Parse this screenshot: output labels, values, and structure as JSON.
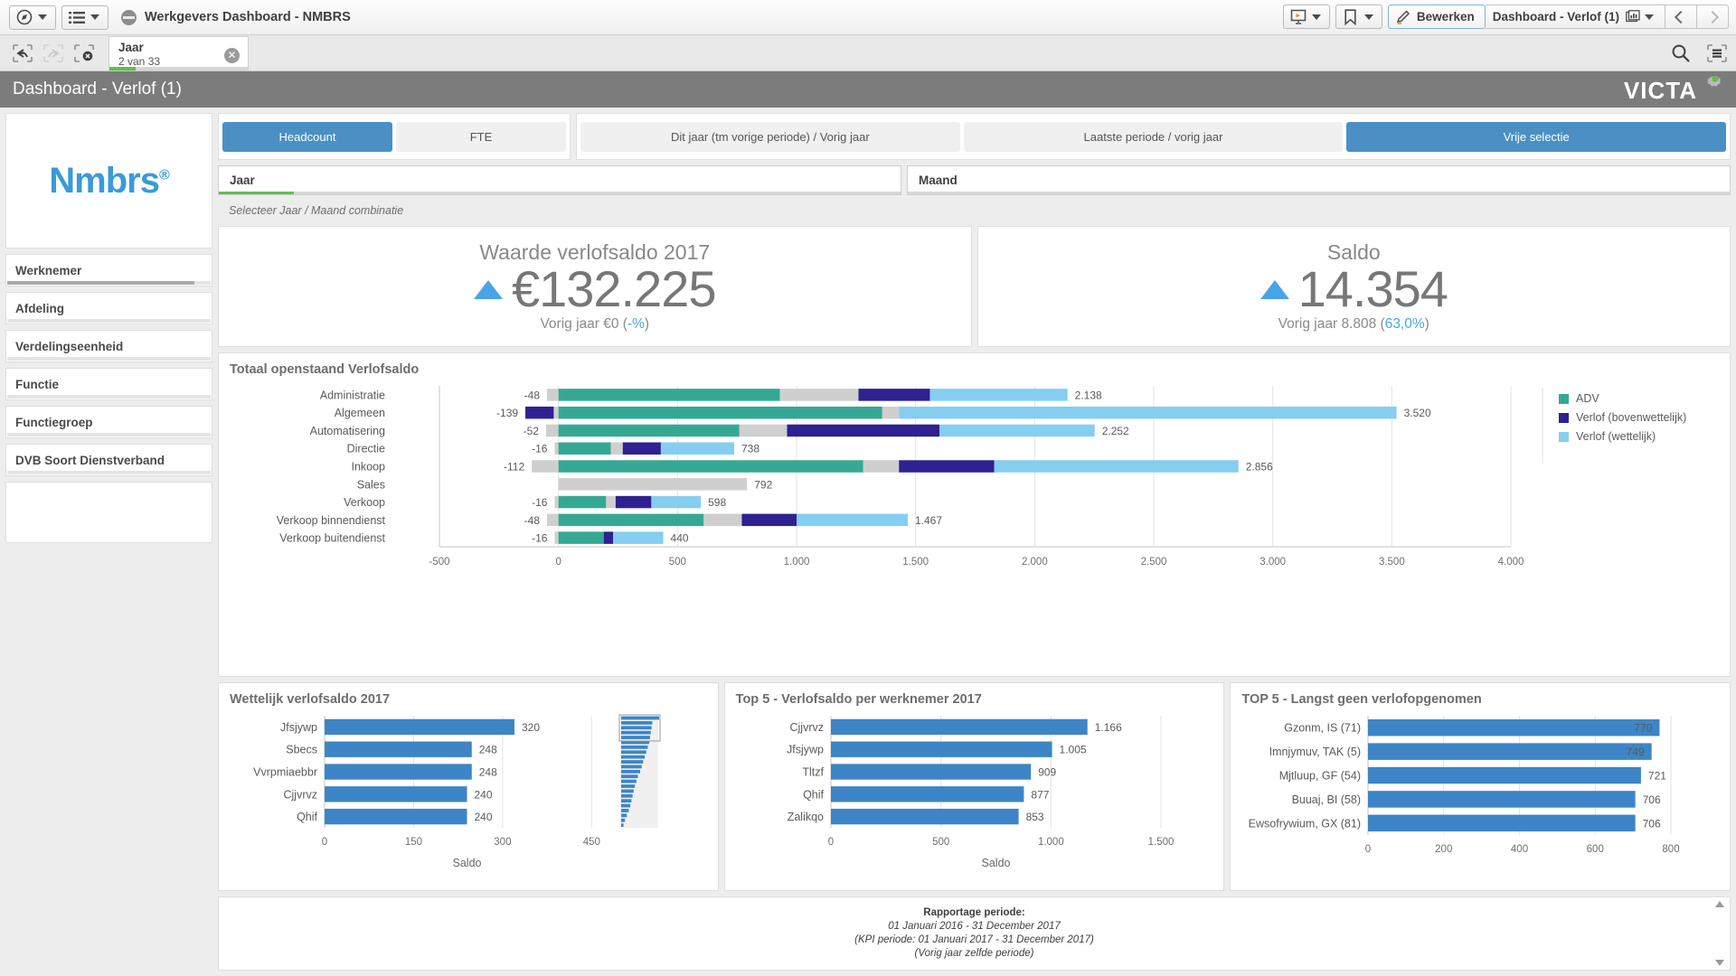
{
  "topbar": {
    "app_title": "Werkgevers Dashboard - NMBRS",
    "nav_icon": "compass-icon",
    "sheets_icon": "list-icon",
    "story_icon": "presentation-icon",
    "bookmark_icon": "bookmark-icon",
    "edit_label": "Bewerken",
    "sheet_label": "Dashboard - Verlof (1)",
    "sheet_icon": "chart-icon",
    "prev_icon": "chevron-left-icon",
    "next_icon": "chevron-right-icon"
  },
  "selectionbar": {
    "back_icon": "step-back-icon",
    "forward_icon": "step-forward-icon",
    "clear_icon": "clear-selections-icon",
    "search_icon": "search-icon",
    "selections_icon": "selection-panel-icon",
    "token": {
      "field": "Jaar",
      "count": "2 van 33",
      "close_icon": "close-icon"
    }
  },
  "appheader": {
    "title": "Dashboard - Verlof (1)",
    "brand": "VICTA"
  },
  "sidebar": {
    "logo": "Nmbrs",
    "logo_sup": "®",
    "items": [
      {
        "label": "Werknemer",
        "fill": 92
      },
      {
        "label": "Afdeling",
        "fill": 0
      },
      {
        "label": "Verdelingseenheid",
        "fill": 0
      },
      {
        "label": "Functie",
        "fill": 0
      },
      {
        "label": "Functiegroep",
        "fill": 0
      },
      {
        "label": "DVB Soort Dienstverband",
        "fill": 0
      }
    ]
  },
  "controls": {
    "measure_buttons": [
      {
        "label": "Headcount",
        "active": true
      },
      {
        "label": "FTE",
        "active": false
      }
    ],
    "period_buttons": [
      {
        "label": "Dit jaar (tm vorige periode) / Vorig jaar",
        "active": false
      },
      {
        "label": "Laatste periode / vorig jaar",
        "active": false
      },
      {
        "label": "Vrije selectie",
        "active": true
      }
    ],
    "listboxes": [
      {
        "label": "Jaar",
        "fill": 11
      },
      {
        "label": "Maand",
        "fill": 0
      }
    ],
    "hint": "Selecteer Jaar / Maand combinatie"
  },
  "kpis": [
    {
      "title": "Waarde verlofsaldo 2017",
      "value": "€132.225",
      "sub_prefix": "Vorig jaar €0 (",
      "sub_delta": "-%",
      "sub_suffix": ")",
      "trend": "up"
    },
    {
      "title": "Saldo",
      "value": "14.354",
      "sub_prefix": "Vorig jaar 8.808 (",
      "sub_delta": "63,0%",
      "sub_suffix": ")",
      "trend": "up"
    }
  ],
  "colors": {
    "adv": "#35a893",
    "verlof_boven": "#2e2191",
    "verlof_wet": "#85cef0",
    "neutral": "#cfcfcf",
    "blue": "#3d85c6",
    "accent": "#4a90c4"
  },
  "footer": {
    "title": "Rapportage periode:",
    "line1": "01 Januari 2016 - 31 December 2017",
    "line2": "(KPI periode: 01 Januari 2017 - 31 December 2017)",
    "line3": "(Vorig jaar zelfde periode)",
    "scroll_up_icon": "scroll-up-icon",
    "scroll_down_icon": "scroll-down-icon"
  },
  "chart_data": [
    {
      "id": "totaal_openstaand",
      "type": "bar",
      "orientation": "horizontal",
      "stacked": true,
      "title": "Totaal openstaand Verlofsaldo",
      "xlabel": "",
      "ylabel": "",
      "xlim": [
        -500,
        4000
      ],
      "xticks": [
        -500,
        0,
        500,
        1000,
        1500,
        2000,
        2500,
        3000,
        3500,
        4000
      ],
      "xticklabels": [
        "-500",
        "0",
        "500",
        "1.000",
        "1.500",
        "2.000",
        "2.500",
        "3.000",
        "3.500",
        "4.000"
      ],
      "grid": true,
      "legend": {
        "position": "right",
        "entries": [
          "ADV",
          "Verlof (bovenwettelijk)",
          "Verlof (wettelijk)"
        ]
      },
      "series_colors": [
        "#35a893",
        "#2e2191",
        "#85cef0"
      ],
      "categories": [
        "Administratie",
        "Algemeen",
        "Automatisering",
        "Directie",
        "Inkoop",
        "Sales",
        "Verkoop",
        "Verkoop binnendienst",
        "Verkoop buitendienst"
      ],
      "negative_labels": [
        "-48",
        "-139",
        "-52",
        "-16",
        "-112",
        "",
        "-16",
        "-48",
        "-16"
      ],
      "total_labels": [
        "2.138",
        "3.520",
        "2.252",
        "738",
        "2.856",
        "792",
        "598",
        "1.467",
        "440"
      ],
      "bars": [
        {
          "category": "Administratie",
          "neg_grey": 48,
          "neg_boven": 0,
          "adv": 930,
          "grey": 330,
          "boven": 300,
          "wettelijk": 578,
          "total": 2138
        },
        {
          "category": "Algemeen",
          "neg_grey": 20,
          "neg_boven": 119,
          "adv": 1360,
          "grey": 70,
          "boven": 0,
          "wettelijk": 2090,
          "total": 3520
        },
        {
          "category": "Automatisering",
          "neg_grey": 52,
          "neg_boven": 0,
          "adv": 760,
          "grey": 200,
          "boven": 640,
          "wettelijk": 652,
          "total": 2252
        },
        {
          "category": "Directie",
          "neg_grey": 16,
          "neg_boven": 0,
          "adv": 220,
          "grey": 50,
          "boven": 160,
          "wettelijk": 308,
          "total": 738
        },
        {
          "category": "Inkoop",
          "neg_grey": 112,
          "neg_boven": 0,
          "adv": 1280,
          "grey": 150,
          "boven": 400,
          "wettelijk": 1026,
          "total": 2856
        },
        {
          "category": "Sales",
          "neg_grey": 0,
          "neg_boven": 0,
          "adv": 0,
          "grey": 792,
          "boven": 0,
          "wettelijk": 0,
          "total": 792
        },
        {
          "category": "Verkoop",
          "neg_grey": 16,
          "neg_boven": 0,
          "adv": 200,
          "grey": 40,
          "boven": 150,
          "wettelijk": 208,
          "total": 598
        },
        {
          "category": "Verkoop binnendienst",
          "neg_grey": 48,
          "neg_boven": 0,
          "adv": 610,
          "grey": 160,
          "boven": 230,
          "wettelijk": 467,
          "total": 1467
        },
        {
          "category": "Verkoop buitendienst",
          "neg_grey": 16,
          "neg_boven": 0,
          "adv": 190,
          "grey": 0,
          "boven": 40,
          "wettelijk": 210,
          "total": 440
        }
      ]
    },
    {
      "id": "wettelijk_verlofsaldo",
      "type": "bar",
      "orientation": "horizontal",
      "title": "Wettelijk verlofsaldo 2017",
      "xlabel": "Saldo",
      "xlim": [
        0,
        480
      ],
      "xticks": [
        0,
        150,
        300,
        450
      ],
      "xticklabels": [
        "0",
        "150",
        "300",
        "450"
      ],
      "grid": true,
      "color": "#3d85c6",
      "categories": [
        "Jfsjywp",
        "Sbecs",
        "Vvrpmiaebbr",
        "Cjjvrvz",
        "Qhif"
      ],
      "values": [
        320,
        248,
        248,
        240,
        240
      ],
      "value_labels": [
        "320",
        "248",
        "248",
        "240",
        "240"
      ],
      "has_minichart": true,
      "minichart_values": [
        100,
        82,
        80,
        78,
        76,
        74,
        70,
        66,
        62,
        58,
        54,
        50,
        44,
        40,
        36,
        33,
        30,
        27,
        24,
        20,
        15,
        10,
        6
      ]
    },
    {
      "id": "top5_verlofsaldo",
      "type": "bar",
      "orientation": "horizontal",
      "title": "Top 5 - Verlofsaldo per werknemer 2017",
      "xlabel": "Saldo",
      "xlim": [
        0,
        1500
      ],
      "xticks": [
        0,
        500,
        1000,
        1500
      ],
      "xticklabels": [
        "0",
        "500",
        "1.000",
        "1.500"
      ],
      "grid": true,
      "color": "#3d85c6",
      "categories": [
        "Cjjvrvz",
        "Jfsjywp",
        "Tltzf",
        "Qhif",
        "Zalikqo"
      ],
      "values": [
        1166,
        1005,
        909,
        877,
        853
      ],
      "value_labels": [
        "1.166",
        "1.005",
        "909",
        "877",
        "853"
      ]
    },
    {
      "id": "top5_langst_geen_verlof",
      "type": "bar",
      "orientation": "horizontal",
      "title": "TOP 5 - Langst geen verlofopgenomen",
      "xlabel": "",
      "xlim": [
        0,
        800
      ],
      "xticks": [
        0,
        200,
        400,
        600,
        800
      ],
      "xticklabels": [
        "0",
        "200",
        "400",
        "600",
        "800"
      ],
      "grid": true,
      "color": "#3d85c6",
      "categories": [
        "Gzonm, IS (71)",
        "Imnjymuv, TAK (5)",
        "Mjtluup, GF (54)",
        "Buuaj, BI (58)",
        "Ewsofrywium, GX (81)"
      ],
      "values": [
        770,
        749,
        721,
        706,
        706
      ],
      "value_labels": [
        "770",
        "749",
        "721",
        "706",
        "706"
      ],
      "labels_inside": [
        true,
        true,
        false,
        false,
        false
      ]
    }
  ]
}
